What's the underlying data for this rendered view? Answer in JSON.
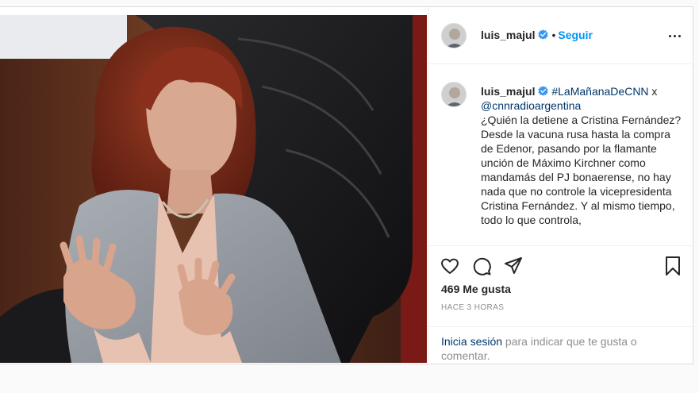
{
  "header": {
    "username": "luis_majul",
    "separator": "•",
    "follow_label": "Seguir"
  },
  "caption": {
    "username": "luis_majul",
    "hashtag": "#LaMañanaDeCNN",
    "connector": " x",
    "mention": "@cnnradioargentina",
    "body": "¿Quién la detiene a Cristina Fernández?\nDesde la vacuna rusa hasta la compra de Edenor, pasando por la flamante unción de Máximo Kirchner como mandamás del PJ bonaerense, no hay nada que no controle la vicepresidenta Cristina Fernández. Y al mismo tiempo, todo lo que controla,"
  },
  "actions": {
    "likes": "469 Me gusta",
    "timestamp": "HACE 3 HORAS",
    "icons": [
      "heart-icon",
      "comment-icon",
      "share-icon",
      "bookmark-icon"
    ]
  },
  "login": {
    "link": "Inicia sesión",
    "rest": " para indicar que te gusta o comentar."
  },
  "colors": {
    "link": "#0095f6",
    "tag": "#00376b",
    "muted": "#8e8e8e",
    "verified": "#3897f0"
  }
}
